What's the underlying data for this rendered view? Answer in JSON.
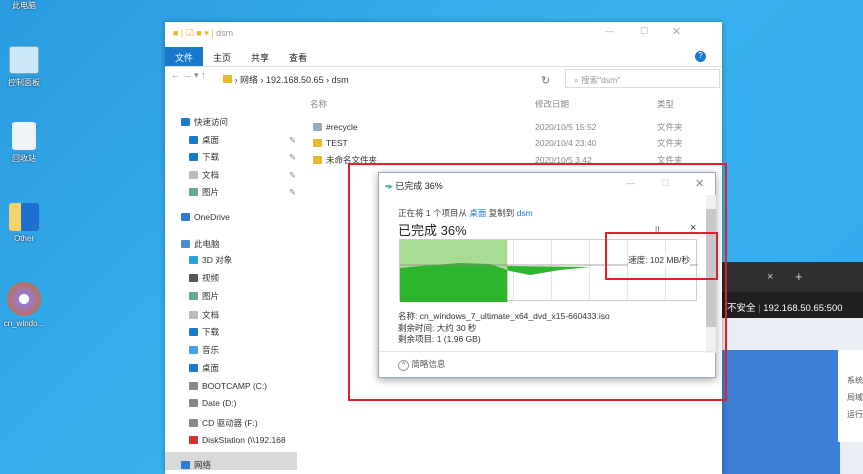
{
  "desktop": {
    "icons": [
      "此电脑",
      "控制面板",
      "回收站",
      "Other",
      "cn_windo..."
    ]
  },
  "browser": {
    "tab_close": "×",
    "tab_new": "+",
    "insecure": "不安全",
    "url": "192.168.50.65:500",
    "card_lines": [
      "系统",
      "局域",
      "运行"
    ]
  },
  "explorer": {
    "title": "dsm",
    "ribbon_tabs": [
      "文件",
      "主页",
      "共享",
      "查看"
    ],
    "breadcrumb": [
      "网络",
      "192.168.50.65",
      "dsm"
    ],
    "search_placeholder": "搜索\"dsm\"",
    "columns": [
      "名称",
      "修改日期",
      "类型"
    ],
    "files": [
      {
        "name": "#recycle",
        "date": "2020/10/5 15:52",
        "type": "文件夹"
      },
      {
        "name": "TEST",
        "date": "2020/10/4 23:40",
        "type": "文件夹"
      },
      {
        "name": "未命名文件夹",
        "date": "2020/10/5 3:42",
        "type": "文件夹"
      }
    ],
    "sidebar": [
      "快速访问",
      "桌面",
      "下载",
      "文档",
      "图片",
      "OneDrive",
      "此电脑",
      "3D 对象",
      "视频",
      "图片",
      "文档",
      "下载",
      "音乐",
      "桌面",
      "BOOTCAMP (C:)",
      "Date (D:)",
      "CD 驱动器 (F:)",
      "DiskStation (\\\\192.168",
      "网络"
    ]
  },
  "dialog": {
    "title": "已完成 36%",
    "copy_line_pre": "正在将 1 个项目从",
    "source": "桌面",
    "copy_mid": "复制到",
    "dest": "dsm",
    "heading": "已完成 36%",
    "progress_percent": 36,
    "speed": "速度: 102 MB/秒",
    "name": "名称: cn_windows_7_ultimate_x64_dvd_x15-660433.iso",
    "time_left": "剩余时间: 大约 30 秒",
    "items_left": "剩余项目: 1 (1.96 GB)",
    "less_info": "简略信息",
    "pause": "II",
    "cancel": "×"
  },
  "colors": {
    "accent": "#1979ca",
    "progress_light": "#a8dc92",
    "progress_dark": "#2db52d",
    "highlight": "#e0202a"
  }
}
